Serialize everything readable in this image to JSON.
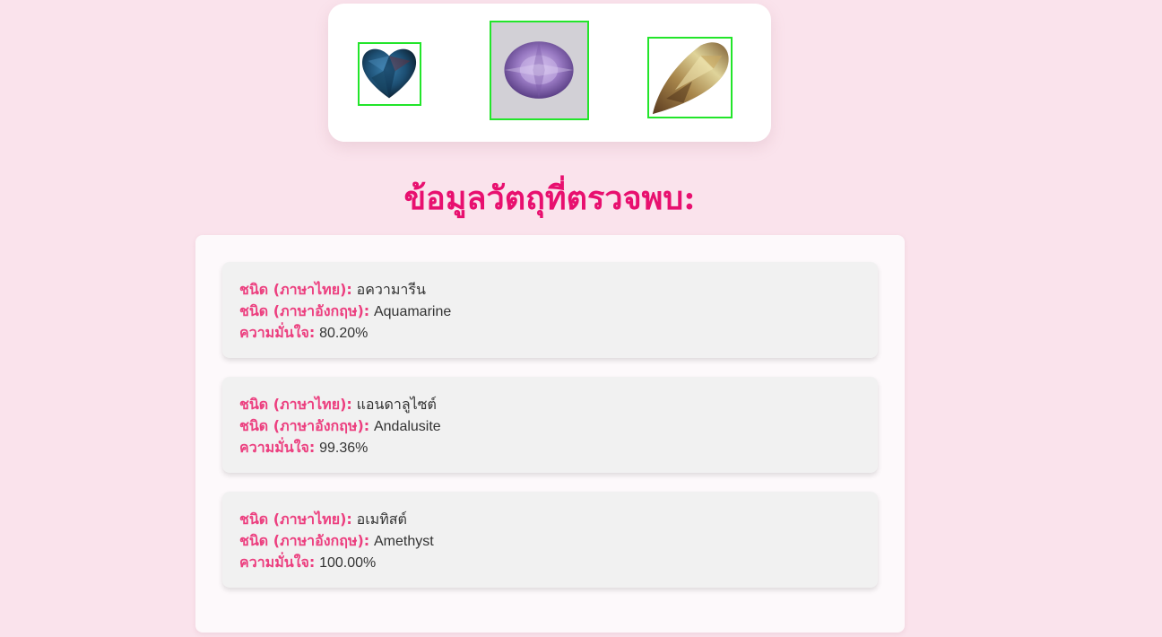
{
  "page": {
    "title": "ข้อมูลวัตถุที่ตรวจพบ:",
    "accent_color": "#e8106f",
    "label_color": "#ec3f7f",
    "box_color": "#22e52a",
    "background_color": "#fae3ec"
  },
  "detection_image": {
    "gems": [
      {
        "icon": "heart-gem-icon",
        "color": "#1d4f73"
      },
      {
        "icon": "oval-gem-icon",
        "color": "#9a7bc4"
      },
      {
        "icon": "pear-gem-icon",
        "color": "#a8864b"
      }
    ]
  },
  "labels": {
    "type_thai": "ชนิด (ภาษาไทย):",
    "type_english": "ชนิด (ภาษาอังกฤษ):",
    "confidence": "ความมั่นใจ:"
  },
  "results": [
    {
      "thai": "อความารีน",
      "english": "Aquamarine",
      "confidence": "80.20%"
    },
    {
      "thai": "แอนดาลูไซต์",
      "english": "Andalusite",
      "confidence": "99.36%"
    },
    {
      "thai": "อเมทิสต์",
      "english": "Amethyst",
      "confidence": "100.00%"
    }
  ]
}
